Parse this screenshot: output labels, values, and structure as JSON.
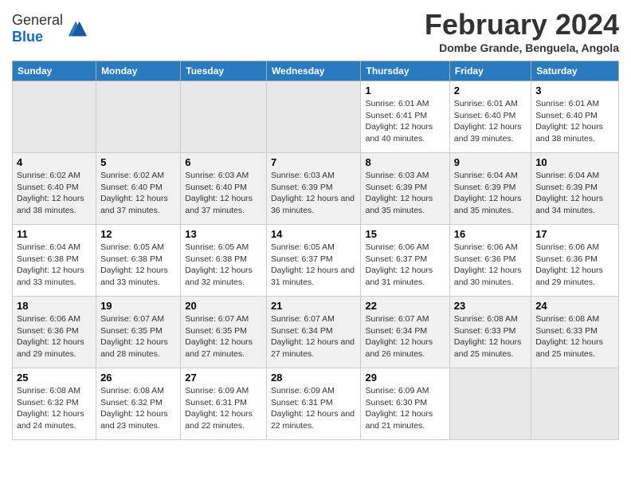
{
  "logo": {
    "general": "General",
    "blue": "Blue"
  },
  "title": "February 2024",
  "subtitle": "Dombe Grande, Benguela, Angola",
  "days_of_week": [
    "Sunday",
    "Monday",
    "Tuesday",
    "Wednesday",
    "Thursday",
    "Friday",
    "Saturday"
  ],
  "weeks": [
    [
      {
        "day": "",
        "info": "",
        "empty": true
      },
      {
        "day": "",
        "info": "",
        "empty": true
      },
      {
        "day": "",
        "info": "",
        "empty": true
      },
      {
        "day": "",
        "info": "",
        "empty": true
      },
      {
        "day": "1",
        "info": "Sunrise: 6:01 AM\nSunset: 6:41 PM\nDaylight: 12 hours and 40 minutes."
      },
      {
        "day": "2",
        "info": "Sunrise: 6:01 AM\nSunset: 6:40 PM\nDaylight: 12 hours and 39 minutes."
      },
      {
        "day": "3",
        "info": "Sunrise: 6:01 AM\nSunset: 6:40 PM\nDaylight: 12 hours and 38 minutes."
      }
    ],
    [
      {
        "day": "4",
        "info": "Sunrise: 6:02 AM\nSunset: 6:40 PM\nDaylight: 12 hours and 38 minutes."
      },
      {
        "day": "5",
        "info": "Sunrise: 6:02 AM\nSunset: 6:40 PM\nDaylight: 12 hours and 37 minutes."
      },
      {
        "day": "6",
        "info": "Sunrise: 6:03 AM\nSunset: 6:40 PM\nDaylight: 12 hours and 37 minutes."
      },
      {
        "day": "7",
        "info": "Sunrise: 6:03 AM\nSunset: 6:39 PM\nDaylight: 12 hours and 36 minutes."
      },
      {
        "day": "8",
        "info": "Sunrise: 6:03 AM\nSunset: 6:39 PM\nDaylight: 12 hours and 35 minutes."
      },
      {
        "day": "9",
        "info": "Sunrise: 6:04 AM\nSunset: 6:39 PM\nDaylight: 12 hours and 35 minutes."
      },
      {
        "day": "10",
        "info": "Sunrise: 6:04 AM\nSunset: 6:39 PM\nDaylight: 12 hours and 34 minutes."
      }
    ],
    [
      {
        "day": "11",
        "info": "Sunrise: 6:04 AM\nSunset: 6:38 PM\nDaylight: 12 hours and 33 minutes."
      },
      {
        "day": "12",
        "info": "Sunrise: 6:05 AM\nSunset: 6:38 PM\nDaylight: 12 hours and 33 minutes."
      },
      {
        "day": "13",
        "info": "Sunrise: 6:05 AM\nSunset: 6:38 PM\nDaylight: 12 hours and 32 minutes."
      },
      {
        "day": "14",
        "info": "Sunrise: 6:05 AM\nSunset: 6:37 PM\nDaylight: 12 hours and 31 minutes."
      },
      {
        "day": "15",
        "info": "Sunrise: 6:06 AM\nSunset: 6:37 PM\nDaylight: 12 hours and 31 minutes."
      },
      {
        "day": "16",
        "info": "Sunrise: 6:06 AM\nSunset: 6:36 PM\nDaylight: 12 hours and 30 minutes."
      },
      {
        "day": "17",
        "info": "Sunrise: 6:06 AM\nSunset: 6:36 PM\nDaylight: 12 hours and 29 minutes."
      }
    ],
    [
      {
        "day": "18",
        "info": "Sunrise: 6:06 AM\nSunset: 6:36 PM\nDaylight: 12 hours and 29 minutes."
      },
      {
        "day": "19",
        "info": "Sunrise: 6:07 AM\nSunset: 6:35 PM\nDaylight: 12 hours and 28 minutes."
      },
      {
        "day": "20",
        "info": "Sunrise: 6:07 AM\nSunset: 6:35 PM\nDaylight: 12 hours and 27 minutes."
      },
      {
        "day": "21",
        "info": "Sunrise: 6:07 AM\nSunset: 6:34 PM\nDaylight: 12 hours and 27 minutes."
      },
      {
        "day": "22",
        "info": "Sunrise: 6:07 AM\nSunset: 6:34 PM\nDaylight: 12 hours and 26 minutes."
      },
      {
        "day": "23",
        "info": "Sunrise: 6:08 AM\nSunset: 6:33 PM\nDaylight: 12 hours and 25 minutes."
      },
      {
        "day": "24",
        "info": "Sunrise: 6:08 AM\nSunset: 6:33 PM\nDaylight: 12 hours and 25 minutes."
      }
    ],
    [
      {
        "day": "25",
        "info": "Sunrise: 6:08 AM\nSunset: 6:32 PM\nDaylight: 12 hours and 24 minutes."
      },
      {
        "day": "26",
        "info": "Sunrise: 6:08 AM\nSunset: 6:32 PM\nDaylight: 12 hours and 23 minutes."
      },
      {
        "day": "27",
        "info": "Sunrise: 6:09 AM\nSunset: 6:31 PM\nDaylight: 12 hours and 22 minutes."
      },
      {
        "day": "28",
        "info": "Sunrise: 6:09 AM\nSunset: 6:31 PM\nDaylight: 12 hours and 22 minutes."
      },
      {
        "day": "29",
        "info": "Sunrise: 6:09 AM\nSunset: 6:30 PM\nDaylight: 12 hours and 21 minutes."
      },
      {
        "day": "",
        "info": "",
        "empty": true
      },
      {
        "day": "",
        "info": "",
        "empty": true
      }
    ]
  ]
}
